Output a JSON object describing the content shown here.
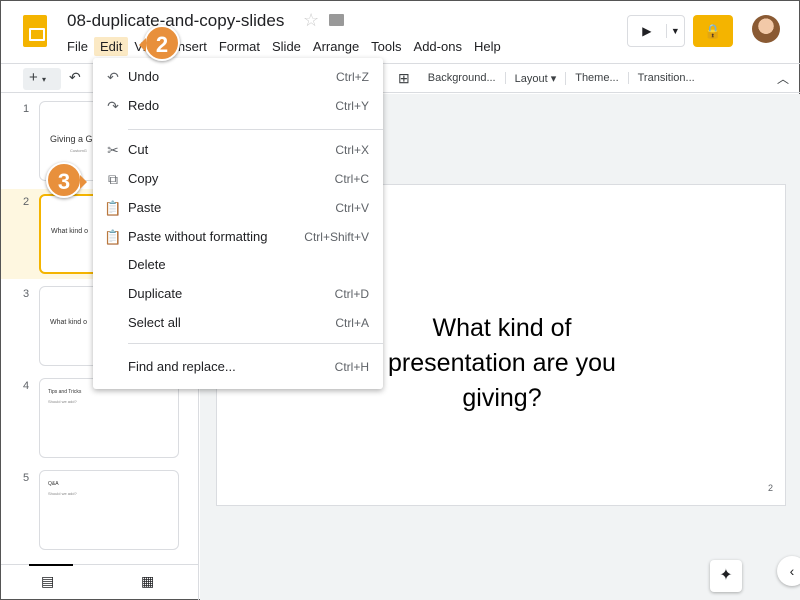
{
  "app": {
    "title": "08-duplicate-and-copy-slides",
    "accent": "#f4b400"
  },
  "menubar": [
    "File",
    "Edit",
    "View",
    "Insert",
    "Format",
    "Slide",
    "Arrange",
    "Tools",
    "Add-ons",
    "Help"
  ],
  "toolbar": {
    "items": [
      "Background...",
      "Layout ▾",
      "Theme...",
      "Transition..."
    ]
  },
  "slides": [
    {
      "num": "1",
      "title": "Giving a G",
      "subtitle": "CustomG"
    },
    {
      "num": "2",
      "title": "What kind o",
      "subtitle": ""
    },
    {
      "num": "3",
      "title": "What kind o",
      "subtitle": ""
    },
    {
      "num": "4",
      "title": "Tips and Tricks",
      "subtitle": "Should we add?"
    },
    {
      "num": "5",
      "title": "Q&A",
      "subtitle": "Should we add?"
    }
  ],
  "current_slide": {
    "text": "What kind of presentation are you giving?",
    "number": "2"
  },
  "edit_menu": [
    {
      "icon": "undo-icon",
      "glyph": "↶",
      "label": "Undo",
      "shortcut": "Ctrl+Z"
    },
    {
      "icon": "redo-icon",
      "glyph": "↷",
      "label": "Redo",
      "shortcut": "Ctrl+Y"
    },
    {
      "icon": "cut-icon",
      "glyph": "✂",
      "label": "Cut",
      "shortcut": "Ctrl+X"
    },
    {
      "icon": "copy-icon",
      "glyph": "⧉",
      "label": "Copy",
      "shortcut": "Ctrl+C"
    },
    {
      "icon": "paste-icon",
      "glyph": "📋",
      "label": "Paste",
      "shortcut": "Ctrl+V"
    },
    {
      "icon": "paste-plain-icon",
      "glyph": "📋",
      "label": "Paste without formatting",
      "shortcut": "Ctrl+Shift+V"
    },
    {
      "icon": "",
      "glyph": "",
      "label": "Delete",
      "shortcut": ""
    },
    {
      "icon": "",
      "glyph": "",
      "label": "Duplicate",
      "shortcut": "Ctrl+D"
    },
    {
      "icon": "",
      "glyph": "",
      "label": "Select all",
      "shortcut": "Ctrl+A"
    },
    {
      "icon": "",
      "glyph": "",
      "label": "Find and replace...",
      "shortcut": "Ctrl+H"
    }
  ],
  "callouts": {
    "step2": "2",
    "step3": "3"
  }
}
